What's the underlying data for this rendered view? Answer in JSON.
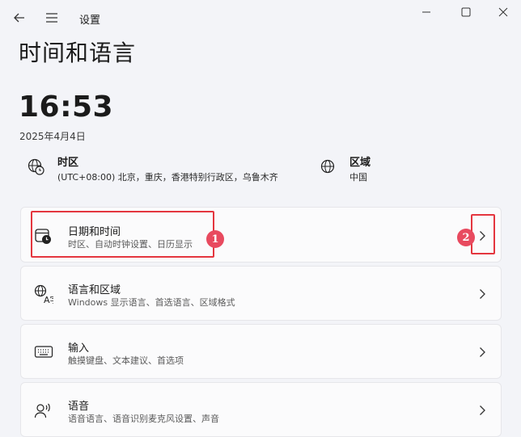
{
  "window": {
    "app_title": "设置"
  },
  "page": {
    "title": "时间和语言"
  },
  "clock": {
    "time": "16:53",
    "date": "2025年4月4日"
  },
  "info": {
    "timezone": {
      "title": "时区",
      "value": "(UTC+08:00) 北京，重庆，香港特别行政区，乌鲁木齐"
    },
    "region": {
      "title": "区域",
      "value": "中国"
    }
  },
  "cards": [
    {
      "title": "日期和时间",
      "subtitle": "时区、自动时钟设置、日历显示",
      "icon": "calendar-clock-icon"
    },
    {
      "title": "语言和区域",
      "subtitle": "Windows 显示语言、首选语言、区域格式",
      "icon": "language-icon"
    },
    {
      "title": "输入",
      "subtitle": "触摸键盘、文本建议、首选项",
      "icon": "keyboard-icon"
    },
    {
      "title": "语音",
      "subtitle": "语音语言、语音识别麦克风设置、声音",
      "icon": "speech-icon"
    }
  ],
  "annotations": [
    {
      "label": "1"
    },
    {
      "label": "2"
    }
  ],
  "colors": {
    "annotation_red": "#e4363f",
    "badge_red": "#e84a5f",
    "background": "#f3f4f8"
  }
}
